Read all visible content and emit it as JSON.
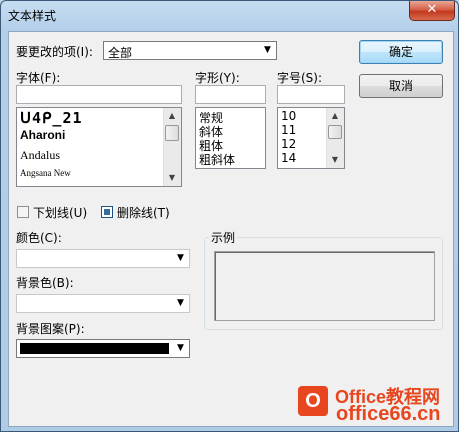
{
  "window": {
    "title": "文本样式",
    "close_label": "✕"
  },
  "fields": {
    "item_to_change_label": "要更改的项(I):",
    "item_to_change_value": "全部",
    "font_label": "字体(F):",
    "font_style_label": "字形(Y):",
    "size_label": "字号(S):",
    "underline_label": "下划线(U)",
    "strikethrough_label": "删除线(T)",
    "color_label": "颜色(C):",
    "background_color_label": "背景色(B):",
    "background_pattern_label": "背景图案(P):",
    "sample_label": "示例"
  },
  "buttons": {
    "ok": "确定",
    "cancel": "取消"
  },
  "font_list": [
    "Aharoni",
    "Andalus",
    "Angsana New"
  ],
  "font_style_list": [
    "常规",
    "斜体",
    "粗体",
    "粗斜体"
  ],
  "size_list": [
    "10",
    "11",
    "12",
    "14"
  ],
  "checkboxes": {
    "underline_checked": false,
    "strikethrough_checked": true
  },
  "background_pattern_color": "#000000",
  "watermark": {
    "brand_line1": "Office教程网",
    "brand_line2": "office66.cn",
    "icon_letter": "O"
  },
  "colors": {
    "accent_brand": "#e8461e",
    "title_bar": "#bcd6ee"
  }
}
